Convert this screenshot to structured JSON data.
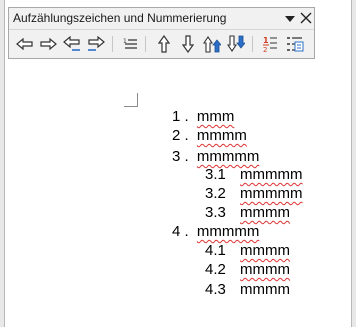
{
  "toolbar": {
    "title": "Aufzählungszeichen und Nummerierung",
    "buttons": [
      {
        "name": "demote-one-level-icon"
      },
      {
        "name": "promote-one-level-icon"
      },
      {
        "name": "demote-with-subpoints-icon"
      },
      {
        "name": "promote-with-subpoints-icon"
      },
      {
        "name": "insert-unnumbered-entry-icon"
      },
      {
        "name": "move-up-icon"
      },
      {
        "name": "move-down-icon"
      },
      {
        "name": "move-up-with-subpoints-icon"
      },
      {
        "name": "move-down-with-subpoints-icon"
      },
      {
        "name": "restart-numbering-icon"
      },
      {
        "name": "numbering-dialog-icon"
      }
    ]
  },
  "document": {
    "items": [
      {
        "number": "1 .",
        "text": "mmm",
        "spell_error": true
      },
      {
        "number": "2 .",
        "text": "mmmm",
        "spell_error": true
      },
      {
        "number": "3 .",
        "text": "mmmmm",
        "spell_error": true
      },
      {
        "number": "3.1",
        "text": "mmmmm",
        "spell_error": true
      },
      {
        "number": "3.2",
        "text": "mmmmm",
        "spell_error": true
      },
      {
        "number": "3.3",
        "text": "mmmm",
        "spell_error": true
      },
      {
        "number": "4 .",
        "text": "mmmmm",
        "spell_error": true
      },
      {
        "number": "4.1",
        "text": "mmmm",
        "spell_error": true
      },
      {
        "number": "4.2",
        "text": "mmmm",
        "spell_error": true
      },
      {
        "number": "4.3",
        "text": "mmmm",
        "spell_error": false
      }
    ]
  },
  "colors": {
    "spell_error_underline": "#e03030",
    "arrow_blue": "#2a6fc9",
    "restart_red": "#d04020"
  }
}
